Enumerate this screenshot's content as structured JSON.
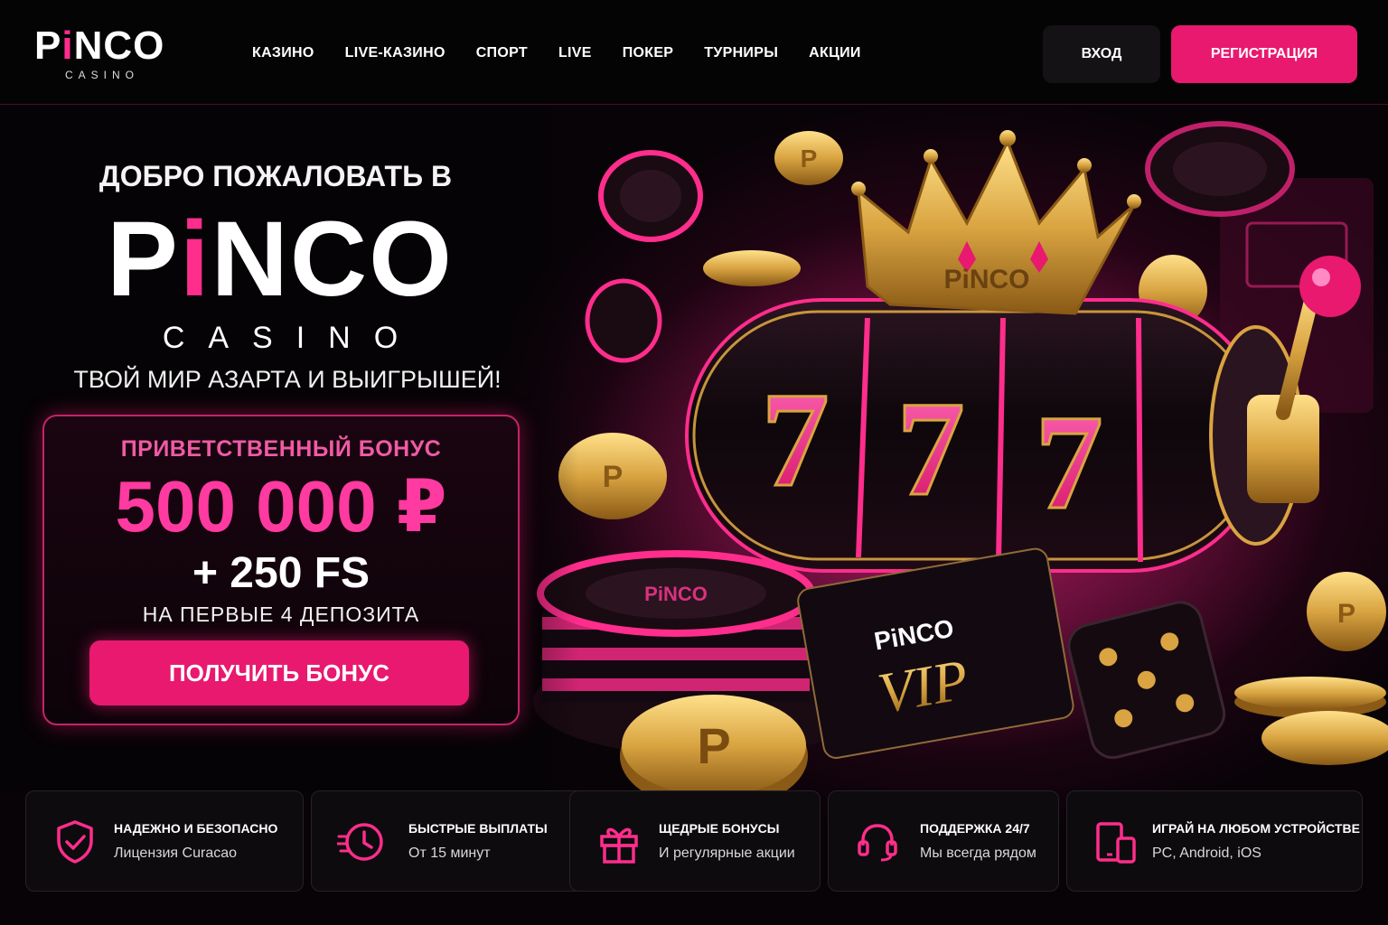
{
  "header": {
    "logo_main_a": "P",
    "logo_main_i": "i",
    "logo_main_b": "NCO",
    "logo_sub": "CASINO",
    "nav": [
      "КАЗИНО",
      "LIVE-КАЗИНО",
      "СПОРТ",
      "LIVE",
      "ПОКЕР",
      "ТУРНИРЫ",
      "АКЦИИ"
    ],
    "login_label": "ВХОД",
    "register_label": "РЕГИСТРАЦИЯ"
  },
  "hero": {
    "welcome": "ДОБРО ПОЖАЛОВАТЬ В",
    "logo_a": "P",
    "logo_i": "i",
    "logo_b": "NCO",
    "casino": "CASINO",
    "tagline": "ТВОЙ МИР АЗАРТА И ВЫИГРЫШЕЙ!",
    "bonus": {
      "title": "ПРИВЕТСТВЕННЫЙ БОНУС",
      "amount": "500 000 ₽",
      "freespins": "+ 250 FS",
      "deposits": "НА ПЕРВЫЕ 4 ДЕПОЗИТА",
      "button": "ПОЛУЧИТЬ БОНУС"
    },
    "art": {
      "crown_text": "PiNCO",
      "reel_symbol": "7",
      "card_brand": "PiNCO",
      "card_tier": "VIP",
      "chip_text": "PiNCO",
      "coin_letter": "P"
    }
  },
  "features": [
    {
      "icon": "shield-check-icon",
      "title": "НАДЕЖНО И БЕЗОПАСНО",
      "subtitle": "Лицензия Curacao"
    },
    {
      "icon": "fast-clock-icon",
      "title": "БЫСТРЫЕ ВЫПЛАТЫ",
      "subtitle": "От 15 минут"
    },
    {
      "icon": "gift-icon",
      "title": "ЩЕДРЫЕ БОНУСЫ",
      "subtitle": "И регулярные акции"
    },
    {
      "icon": "headset-icon",
      "title": "ПОДДЕРЖКА 24/7",
      "subtitle": "Мы всегда рядом"
    },
    {
      "icon": "devices-icon",
      "title": "ИГРАЙ НА ЛЮБОМ УСТРОЙСТВЕ",
      "subtitle": "PC, Android, iOS"
    }
  ],
  "colors": {
    "accent": "#e8196f",
    "accent_light": "#ff3aa0",
    "background": "#050305",
    "gold": "#d9a441"
  }
}
